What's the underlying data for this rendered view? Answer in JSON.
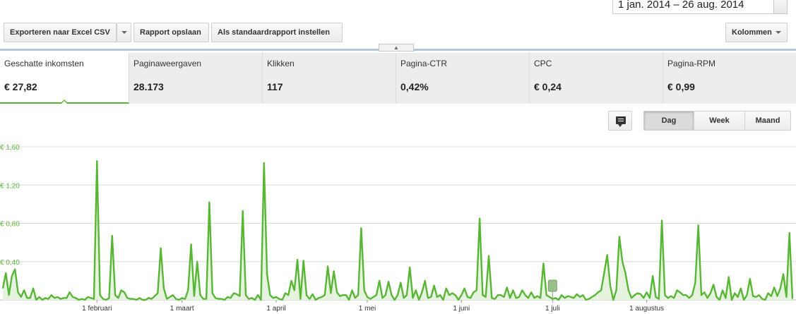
{
  "date_range": {
    "label": "1 jan. 2014 – 26 aug. 2014"
  },
  "toolbar": {
    "export_label": "Exporteren naar Excel CSV",
    "save_label": "Rapport opslaan",
    "default_label": "Als standaardrapport instellen",
    "columns_label": "Kolommen"
  },
  "metrics": [
    {
      "label": "Geschatte inkomsten",
      "value": "€ 27,82"
    },
    {
      "label": "Paginaweergaven",
      "value": "28.173"
    },
    {
      "label": "Klikken",
      "value": "117"
    },
    {
      "label": "Pagina-CTR",
      "value": "0,42%"
    },
    {
      "label": "CPC",
      "value": "€ 0,24"
    },
    {
      "label": "Pagina-RPM",
      "value": "€ 0,99"
    }
  ],
  "granularity": {
    "day": "Dag",
    "week": "Week",
    "month": "Maand",
    "selected": "Dag"
  },
  "chart_data": {
    "type": "area",
    "x_start": "2014-01-01",
    "x_end": "2014-08-26",
    "ylim": [
      0,
      1.6
    ],
    "y_ticks": [
      "€ 0,40",
      "€ 0,80",
      "€ 1,20",
      "€ 1,60"
    ],
    "x_ticks": [
      "1 februari",
      "1 maart",
      "1 april",
      "1 mei",
      "1 juni",
      "1 juli",
      "1 augustus"
    ],
    "grid": true,
    "line_color": "#58b635",
    "fill_color": "#e6f3df",
    "values": [
      0.12,
      0.28,
      0.05,
      0.25,
      0.32,
      0.08,
      0.03,
      0.1,
      0.02,
      0.02,
      0.12,
      0.0,
      0.03,
      0.0,
      0.02,
      0.01,
      0.05,
      0.02,
      0.03,
      0.01,
      0.02,
      0.02,
      0.08,
      0.03,
      0.02,
      0.0,
      0.01,
      0.0,
      0.03,
      0.02,
      0.01,
      1.45,
      0.05,
      0.01,
      0.0,
      0.02,
      0.67,
      0.05,
      0.02,
      0.1,
      0.08,
      0.02,
      0.01,
      0.01,
      0.0,
      0.02,
      0.0,
      0.0,
      0.02,
      0.01,
      0.04,
      0.07,
      0.54,
      0.12,
      0.01,
      0.03,
      0.05,
      0.01,
      0.0,
      0.02,
      0.01,
      0.1,
      0.58,
      0.04,
      0.4,
      0.05,
      0.01,
      0.01,
      1.02,
      0.07,
      0.02,
      0.01,
      0.01,
      0.0,
      0.03,
      0.02,
      0.07,
      0.06,
      0.04,
      0.93,
      0.05,
      0.01,
      0.02,
      0.0,
      0.05,
      0.0,
      1.43,
      0.27,
      0.05,
      0.02,
      0.03,
      0.01,
      0.0,
      0.07,
      0.05,
      0.2,
      0.1,
      0.42,
      0.01,
      0.41,
      0.05,
      0.01,
      0.06,
      0.0,
      0.02,
      0.03,
      0.05,
      0.35,
      0.07,
      0.3,
      0.08,
      0.04,
      0.05,
      0.05,
      0.0,
      0.1,
      0.02,
      0.05,
      0.75,
      0.1,
      0.03,
      0.01,
      0.03,
      0.05,
      0.2,
      0.02,
      0.05,
      0.19,
      0.05,
      0.0,
      0.05,
      0.18,
      0.02,
      0.05,
      0.34,
      0.02,
      0.1,
      0.0,
      0.08,
      0.2,
      0.02,
      0.03,
      0.15,
      0.03,
      0.05,
      0.0,
      0.12,
      0.05,
      0.07,
      0.05,
      0.0,
      0.05,
      0.12,
      0.03,
      0.02,
      0.08,
      0.1,
      0.85,
      0.05,
      0.03,
      0.46,
      0.02,
      0.01,
      0.05,
      0.05,
      0.03,
      0.13,
      0.02,
      0.1,
      0.02,
      0.03,
      0.1,
      0.05,
      0.02,
      0.08,
      0.02,
      0.04,
      0.02,
      0.38,
      0.05,
      0.03,
      0.01,
      0.02,
      0.0,
      0.05,
      0.02,
      0.04,
      0.03,
      0.02,
      0.06,
      0.03,
      0.05,
      0.0,
      0.01,
      0.03,
      0.05,
      0.08,
      0.1,
      0.28,
      0.47,
      0.15,
      0.0,
      0.1,
      0.66,
      0.4,
      0.28,
      0.1,
      0.02,
      0.05,
      0.07,
      0.06,
      0.02,
      0.08,
      0.02,
      0.25,
      0.03,
      0.01,
      0.83,
      0.05,
      0.02,
      0.04,
      0.02,
      0.1,
      0.08,
      0.05,
      0.05,
      0.02,
      0.05,
      0.18,
      0.78,
      0.05,
      0.08,
      0.02,
      0.07,
      0.16,
      0.03,
      0.0,
      0.1,
      0.02,
      0.24,
      0.0,
      0.07,
      0.03,
      0.12,
      0.0,
      0.05,
      0.22,
      0.04,
      0.03,
      0.05,
      0.01,
      0.0,
      0.07,
      0.04,
      0.13,
      0.04,
      0.12,
      0.27,
      0.03,
      0.7,
      0.01
    ]
  }
}
